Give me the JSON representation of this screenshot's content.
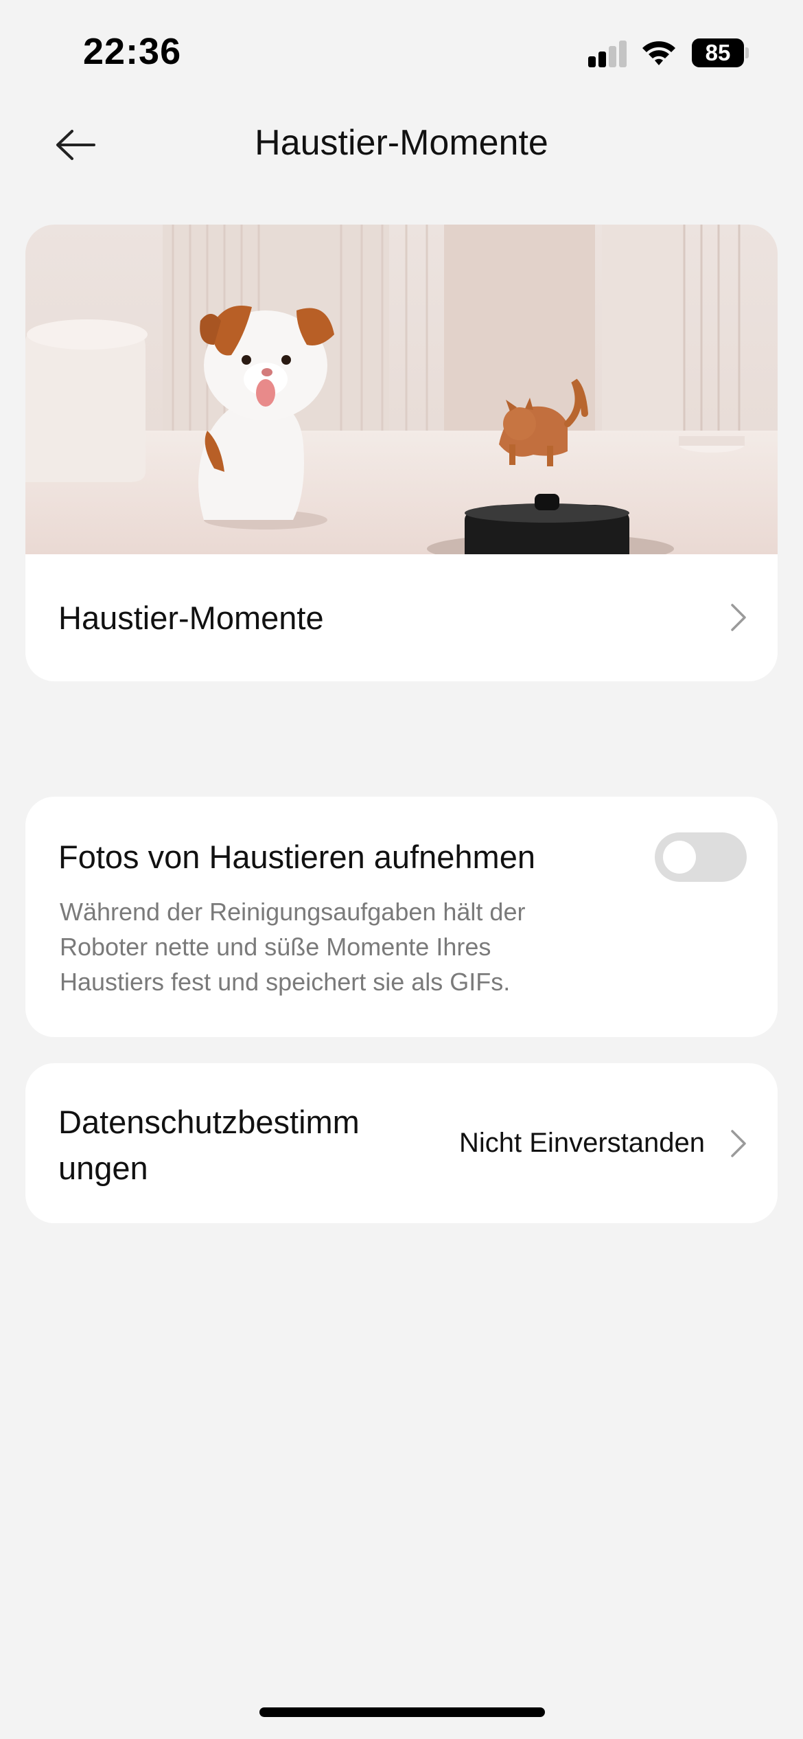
{
  "status_bar": {
    "time": "22:36",
    "battery_level": "85",
    "signal_icon": "cellular-signal-icon",
    "wifi_icon": "wifi-icon"
  },
  "header": {
    "back_icon": "arrow-left-icon",
    "title": "Haustier-Momente"
  },
  "hero_card": {
    "image_desc": "pet-moments-illustration",
    "label": "Haustier-Momente",
    "chevron_icon": "chevron-right-icon"
  },
  "pet_photos": {
    "title": "Fotos von Haustieren aufnehmen",
    "toggle_on": false,
    "description": "Während der Reinigungsaufgaben hält der Roboter nette und süße Momente Ihres Haustiers fest und speichert sie als GIFs."
  },
  "privacy": {
    "label": "Datenschutzbestimm ungen",
    "value": "Nicht Einverstanden",
    "chevron_icon": "chevron-right-icon"
  },
  "colors": {
    "background": "#f3f3f3",
    "card": "#ffffff",
    "secondary_text": "#7a7a7a",
    "toggle_off": "#dddddd"
  }
}
